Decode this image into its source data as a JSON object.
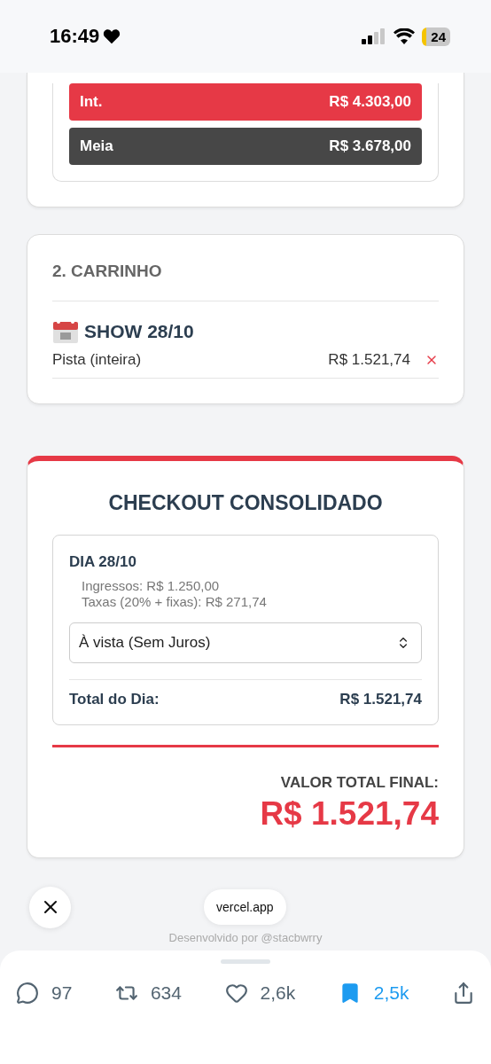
{
  "status_bar": {
    "time": "16:49",
    "battery": "24"
  },
  "prices": [
    {
      "label": "Int.",
      "value": "R$ 4.303,00",
      "selected": true
    },
    {
      "label": "Meia",
      "value": "R$ 3.678,00",
      "selected": false
    }
  ],
  "cart": {
    "title": "2. CARRINHO",
    "shows": [
      {
        "title": "SHOW 28/10",
        "items": [
          {
            "name": "Pista (inteira)",
            "price": "R$ 1.521,74"
          }
        ]
      }
    ]
  },
  "checkout": {
    "title": "CHECKOUT CONSOLIDADO",
    "days": [
      {
        "title": "DIA 28/10",
        "lines": [
          "Ingressos: R$ 1.250,00",
          "Taxas (20% + fixas): R$ 271,74"
        ],
        "payment": "À vista (Sem Juros)",
        "total_label": "Total do Dia:",
        "total": "R$ 1.521,74"
      }
    ],
    "final_label": "VALOR TOTAL FINAL:",
    "final_value": "R$ 1.521,74"
  },
  "browser": {
    "domain": "vercel.app",
    "footer": "Desenvolvido por @stacbwrry"
  },
  "actions": [
    {
      "kind": "reply",
      "count": "97",
      "selected": false
    },
    {
      "kind": "repost",
      "count": "634",
      "selected": false
    },
    {
      "kind": "like",
      "count": "2,6k",
      "selected": false
    },
    {
      "kind": "bookmark",
      "count": "2,5k",
      "selected": true
    },
    {
      "kind": "share"
    }
  ]
}
